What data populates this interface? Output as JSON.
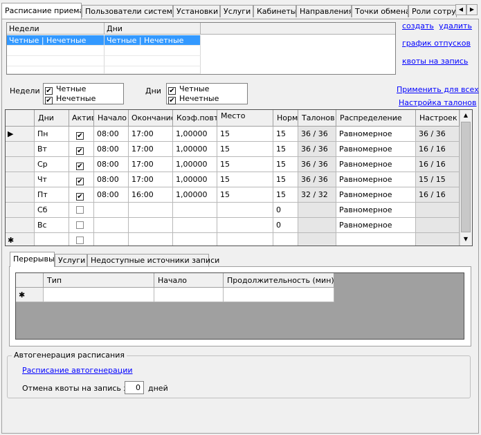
{
  "tabs": [
    {
      "label": "Расписание приема",
      "active": true
    },
    {
      "label": "Пользователи системы"
    },
    {
      "label": "Установки"
    },
    {
      "label": "Услуги"
    },
    {
      "label": "Кабинеты"
    },
    {
      "label": "Направления"
    },
    {
      "label": "Точки обмена"
    },
    {
      "label": "Роли сотруд"
    }
  ],
  "tab_scroll": {
    "left_icon": "◀",
    "right_icon": "▶"
  },
  "week_grid": {
    "headers": [
      "Недели",
      "Дни"
    ],
    "rows": [
      {
        "weeks": "Четные | Нечетные",
        "days": "Четные | Нечетные",
        "selected": true
      }
    ]
  },
  "links": {
    "create": "создать",
    "delete": "удалить",
    "vacation": "график отпусков",
    "quotas": "квоты на запись",
    "apply_all": "Применить для всех",
    "coupon_settings": "Настройка талонов",
    "autogen_schedule": "Расписание автогенерации"
  },
  "weeks_filter": {
    "label": "Недели",
    "options": [
      {
        "label": "Четные",
        "checked": true
      },
      {
        "label": "Нечетные",
        "checked": true
      }
    ]
  },
  "days_filter": {
    "label": "Дни",
    "options": [
      {
        "label": "Четные",
        "checked": true
      },
      {
        "label": "Нечетные",
        "checked": true
      }
    ]
  },
  "schedule": {
    "headers": [
      "Дни",
      "Актив",
      "Начало",
      "Окончание",
      "Коэф.повт.",
      "Место",
      "Норм",
      "Талонов",
      "Распределение",
      "Настроек"
    ],
    "rows": [
      {
        "day": "Пн",
        "active": true,
        "start": "08:00",
        "end": "17:00",
        "coef": "1,00000",
        "place": "15",
        "norm": "15",
        "coupons": "36 / 36",
        "distribution": "Равномерное",
        "settings": "36 / 36",
        "current": true
      },
      {
        "day": "Вт",
        "active": true,
        "start": "08:00",
        "end": "17:00",
        "coef": "1,00000",
        "place": "15",
        "norm": "15",
        "coupons": "36 / 36",
        "distribution": "Равномерное",
        "settings": "16 / 16"
      },
      {
        "day": "Ср",
        "active": true,
        "start": "08:00",
        "end": "17:00",
        "coef": "1,00000",
        "place": "15",
        "norm": "15",
        "coupons": "36 / 36",
        "distribution": "Равномерное",
        "settings": "16 / 16"
      },
      {
        "day": "Чт",
        "active": true,
        "start": "08:00",
        "end": "17:00",
        "coef": "1,00000",
        "place": "15",
        "norm": "15",
        "coupons": "36 / 36",
        "distribution": "Равномерное",
        "settings": "15 / 15"
      },
      {
        "day": "Пт",
        "active": true,
        "start": "08:00",
        "end": "16:00",
        "coef": "1,00000",
        "place": "15",
        "norm": "15",
        "coupons": "32 / 32",
        "distribution": "Равномерное",
        "settings": "16 / 16"
      },
      {
        "day": "Сб",
        "active": false,
        "start": "",
        "end": "",
        "coef": "",
        "place": "",
        "norm": "0",
        "coupons": "",
        "distribution": "Равномерное",
        "settings": ""
      },
      {
        "day": "Вс",
        "active": false,
        "start": "",
        "end": "",
        "coef": "",
        "place": "",
        "norm": "0",
        "coupons": "",
        "distribution": "Равномерное",
        "settings": ""
      }
    ],
    "new_row_marker": "✱",
    "current_row_marker": "▶"
  },
  "bottom_tabs": [
    {
      "label": "Перерывы",
      "active": true
    },
    {
      "label": "Услуги"
    },
    {
      "label": "Недоступные источники записи"
    }
  ],
  "breaks": {
    "headers": [
      "Тип",
      "Начало",
      "Продолжительность (мин)"
    ],
    "new_row_marker": "✱"
  },
  "autogen": {
    "title": "Автогенерация расписания",
    "cancel_label": "Отмена квоты на запись за",
    "days_value": "0",
    "days_unit": "дней"
  }
}
